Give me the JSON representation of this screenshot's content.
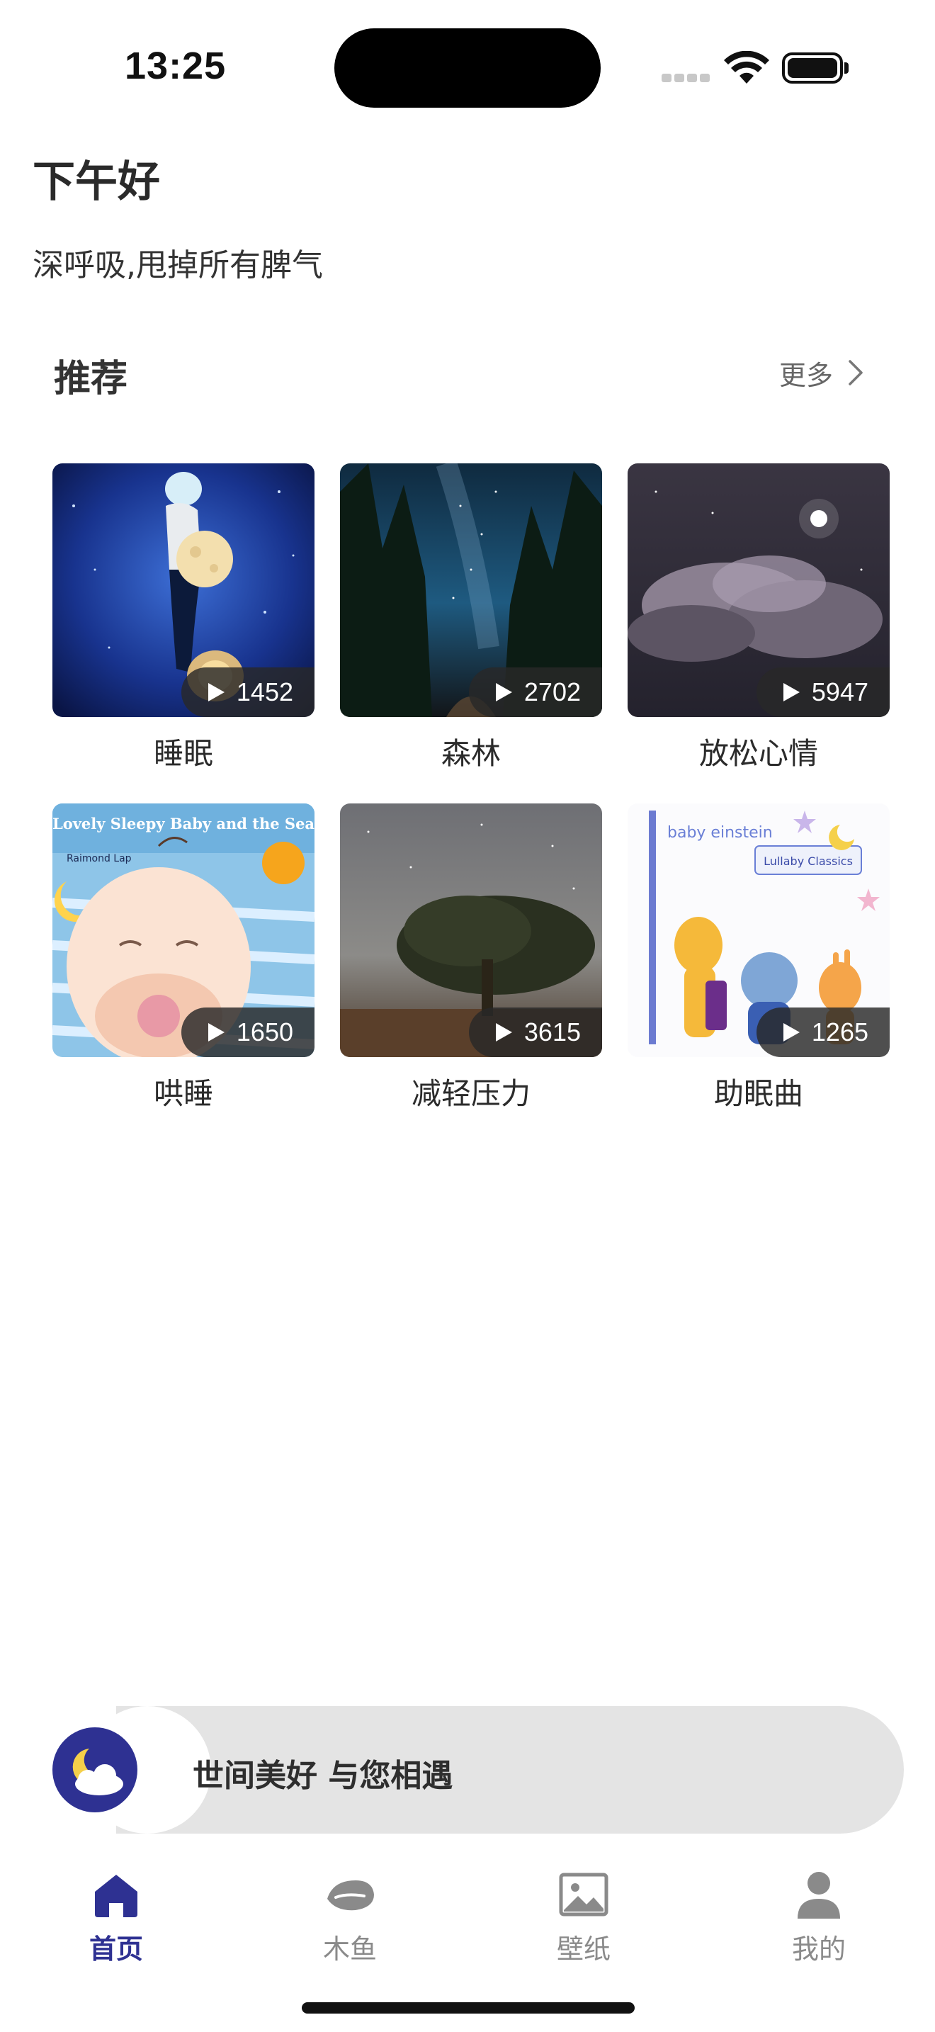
{
  "status_bar": {
    "time": "13:25"
  },
  "header": {
    "greeting": "下午好",
    "tagline": "深呼吸,甩掉所有脾气"
  },
  "recommend": {
    "title": "推荐",
    "more_label": "更多",
    "items": [
      {
        "title": "睡眠",
        "plays": "1452"
      },
      {
        "title": "森林",
        "plays": "2702"
      },
      {
        "title": "放松心情",
        "plays": "5947"
      },
      {
        "title": "哄睡",
        "plays": "1650"
      },
      {
        "title": "减轻压力",
        "plays": "3615"
      },
      {
        "title": "助眠曲",
        "plays": "1265"
      }
    ]
  },
  "mini_player": {
    "message": "世间美好 与您相遇"
  },
  "tabs": [
    {
      "label": "首页",
      "icon": "home-icon",
      "active": true
    },
    {
      "label": "木鱼",
      "icon": "wooden-fish-icon",
      "active": false
    },
    {
      "label": "壁纸",
      "icon": "image-icon",
      "active": false
    },
    {
      "label": "我的",
      "icon": "person-icon",
      "active": false
    }
  ],
  "colors": {
    "accent": "#2e3192",
    "inactive": "#8a8a8a",
    "player_bg": "#e4e4e4"
  },
  "artwork_text": {
    "lullaby_cover_title": "Lovely Sleepy Baby and the Sea",
    "lullaby_cover_artist": "Raimond Lap",
    "baby_einstein_logo": "baby einstein",
    "lullaby_classics": "Lullaby Classics"
  }
}
